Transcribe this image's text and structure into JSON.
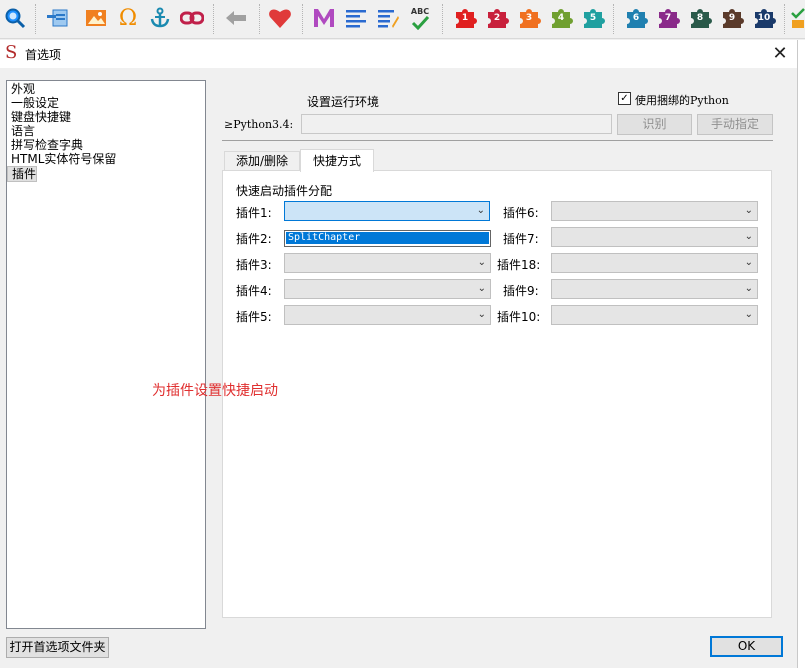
{
  "dialog": {
    "title": "首选项",
    "logo_char": "S",
    "close_glyph": "✕"
  },
  "sidebar": {
    "items": [
      {
        "label": "外观"
      },
      {
        "label": "一般设定"
      },
      {
        "label": "键盘快捷键"
      },
      {
        "label": "语言"
      },
      {
        "label": "拼写检查字典"
      },
      {
        "label": "HTML实体符号保留"
      },
      {
        "label": "插件"
      }
    ],
    "selected": "插件",
    "open_prefs_button": "打开首选项文件夹"
  },
  "python": {
    "header": "设置运行环境",
    "use_bundled_label": "使用捆绑的Python",
    "use_bundled_checked": true,
    "prompt": "≥Python3.4:",
    "path_value": "",
    "identify_button": "识别",
    "manual_button": "手动指定"
  },
  "tabs": [
    {
      "label": "添加/删除",
      "active": false
    },
    {
      "label": "快捷方式",
      "active": true
    }
  ],
  "shortcuts": {
    "section_title": "快速启动插件分配",
    "left": [
      {
        "label": "插件1:",
        "value": ""
      },
      {
        "label": "插件2:",
        "value": ""
      },
      {
        "label": "插件3:",
        "value": ""
      },
      {
        "label": "插件4:",
        "value": ""
      },
      {
        "label": "插件5:",
        "value": ""
      }
    ],
    "right": [
      {
        "label": "插件6:",
        "value": ""
      },
      {
        "label": "插件7:",
        "value": ""
      },
      {
        "label": "插件18:",
        "value": ""
      },
      {
        "label": "插件9:",
        "value": ""
      },
      {
        "label": "插件10:",
        "value": ""
      }
    ],
    "dropdown_option": "SplitChapter"
  },
  "annotation": "为插件设置快捷启动",
  "ok_button": "OK",
  "toolbar": {
    "icons": [
      "search-icon",
      "insert-file-icon",
      "image-icon",
      "omega-icon",
      "anchor-icon",
      "link-icon",
      "back-arrow-icon",
      "heart-icon",
      "m-icon",
      "list-icon",
      "list-edit-icon",
      "spellcheck-icon"
    ],
    "spellcheck_text": "ABC",
    "plugins_red": [
      "1",
      "2",
      "3",
      "4",
      "5"
    ],
    "plugins_blue": [
      "6",
      "7",
      "8",
      "9",
      "10"
    ],
    "colors": {
      "p1": "#e02020",
      "p2": "#c8203c",
      "p3": "#f07020",
      "p4": "#70a030",
      "p5": "#20a0a0",
      "p6": "#2080b0",
      "p7": "#8a2a8a",
      "p8": "#2a5a4a",
      "p9": "#5a3a2a",
      "p10": "#1a3a6a"
    }
  }
}
